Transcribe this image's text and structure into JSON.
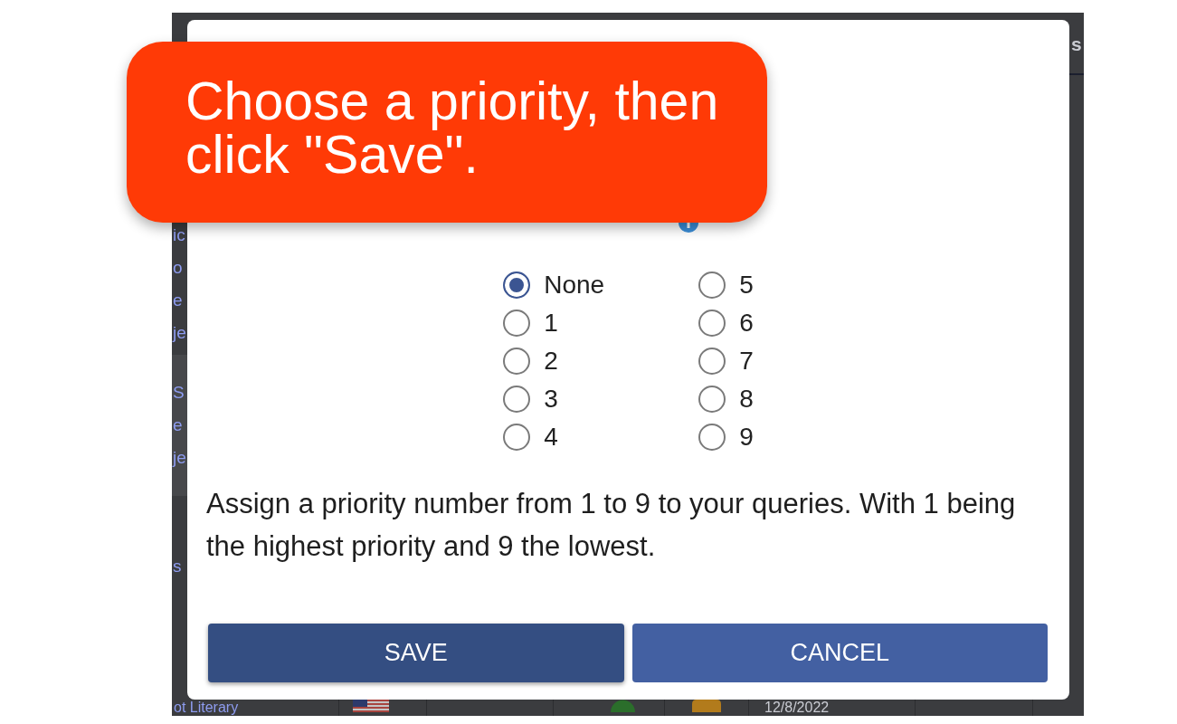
{
  "background": {
    "side_column": [
      {
        "shaded": false,
        "lines": [
          "ic",
          "o",
          "e",
          "je"
        ]
      },
      {
        "shaded": true,
        "lines": [
          "S",
          "e",
          "je"
        ]
      },
      {
        "shaded": false,
        "lines": [
          "s"
        ]
      }
    ],
    "header_fragment": "s",
    "bottom_row": {
      "column_1": "ot Literary",
      "column_6": "12/8/2022"
    }
  },
  "dialog": {
    "options": [
      {
        "label": "None",
        "selected": true
      },
      {
        "label": "1",
        "selected": false
      },
      {
        "label": "2",
        "selected": false
      },
      {
        "label": "3",
        "selected": false
      },
      {
        "label": "4",
        "selected": false
      },
      {
        "label": "5",
        "selected": false
      },
      {
        "label": "6",
        "selected": false
      },
      {
        "label": "7",
        "selected": false
      },
      {
        "label": "8",
        "selected": false
      },
      {
        "label": "9",
        "selected": false
      }
    ],
    "description": "Assign a priority number from 1 to 9 to your queries. With 1 being the highest priority and 9 the lowest.",
    "buttons": [
      {
        "label": "SAVE",
        "focused": true
      },
      {
        "label": "CANCEL",
        "focused": false
      }
    ]
  },
  "callout": {
    "text": "Choose a priority, then click \"Save\"."
  }
}
